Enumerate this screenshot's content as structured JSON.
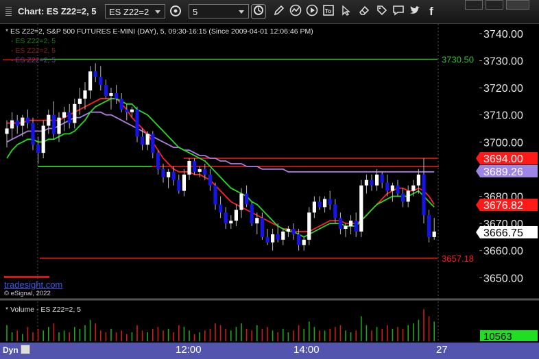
{
  "window": {
    "title": "Chart: ES Z22=2, 5",
    "symbol_combo": "ES Z22=2",
    "interval_combo": "5",
    "toolbar_icons": [
      "refresh-icon",
      "clock-icon",
      "pencil-icon",
      "chart-wave-icon",
      "play-icon",
      "to-icon",
      "eraser-icon",
      "comment-icon",
      "twitter-icon",
      "facebook-icon"
    ]
  },
  "chart_header": {
    "info": "* ES Z22=2, S&P 500 FUTURES E-MINI (DAY), 5, 09:30-16:15 (Since 2009-04-01 12:06:46 PM)",
    "overlay_1": "- ES Z22=2, 5",
    "overlay_2": "- ES Z22=2, 5",
    "overlay_3": "- ES Z22=2, 5"
  },
  "branding": {
    "site": "tradesight.com",
    "copyright": "© eSignal, 2022"
  },
  "volume_header": "* Volume - ES Z22=2, 5",
  "time_axis": {
    "dyn": "Dyn",
    "labels": [
      "12:00",
      "14:00",
      "27"
    ]
  },
  "colors": {
    "up_candle": "#ffffff",
    "down_candle": "#1515e8",
    "ma_green": "#22dd22",
    "ma_red": "#ff2222",
    "ma_purple": "#b07be0",
    "level_red": "#ff1a1a",
    "level_green": "#30c030",
    "axis_bg": "#5254ad",
    "volume_green": "#1aa81a",
    "volume_red": "#d01a1a"
  },
  "chart_data": {
    "type": "candlestick",
    "y_ticks": [
      "3740.00",
      "3730.00",
      "3720.00",
      "3710.00",
      "3700.00",
      "3690.00",
      "3680.00",
      "3670.00",
      "3660.00",
      "3650.00"
    ],
    "ylim": [
      3642.5,
      3743.5
    ],
    "candles": [
      [
        3703,
        3708,
        3698,
        3705
      ],
      [
        3705,
        3711,
        3701,
        3708
      ],
      [
        3708,
        3710,
        3703,
        3706
      ],
      [
        3706,
        3710,
        3702,
        3709
      ],
      [
        3709,
        3712,
        3705,
        3707
      ],
      [
        3707,
        3709,
        3697,
        3699
      ],
      [
        3699,
        3702,
        3692,
        3696
      ],
      [
        3696,
        3708,
        3694,
        3706
      ],
      [
        3706,
        3712,
        3703,
        3710
      ],
      [
        3710,
        3715,
        3701,
        3703
      ],
      [
        3703,
        3711,
        3700,
        3709
      ],
      [
        3709,
        3713,
        3704,
        3711
      ],
      [
        3711,
        3714,
        3705,
        3707
      ],
      [
        3707,
        3716,
        3705,
        3714
      ],
      [
        3714,
        3720,
        3710,
        3716
      ],
      [
        3716,
        3722,
        3712,
        3719
      ],
      [
        3719,
        3728,
        3716,
        3726
      ],
      [
        3726,
        3729,
        3722,
        3724
      ],
      [
        3724,
        3728,
        3719,
        3721
      ],
      [
        3721,
        3723,
        3716,
        3717
      ],
      [
        3717,
        3720,
        3712,
        3718
      ],
      [
        3718,
        3721,
        3714,
        3716
      ],
      [
        3716,
        3718,
        3711,
        3712
      ],
      [
        3712,
        3714,
        3708,
        3711
      ],
      [
        3711,
        3713,
        3709,
        3712
      ],
      [
        3712,
        3713,
        3700,
        3702
      ],
      [
        3702,
        3705,
        3697,
        3699
      ],
      [
        3699,
        3704,
        3697,
        3703
      ],
      [
        3703,
        3704,
        3694,
        3696
      ],
      [
        3696,
        3697,
        3688,
        3690
      ],
      [
        3690,
        3692,
        3685,
        3687
      ],
      [
        3687,
        3690,
        3683,
        3689
      ],
      [
        3689,
        3691,
        3684,
        3686
      ],
      [
        3686,
        3688,
        3681,
        3682
      ],
      [
        3682,
        3690,
        3680,
        3688
      ],
      [
        3688,
        3694,
        3686,
        3693
      ],
      [
        3693,
        3694,
        3688,
        3689
      ],
      [
        3689,
        3691,
        3687,
        3690
      ],
      [
        3690,
        3692,
        3686,
        3688
      ],
      [
        3688,
        3690,
        3682,
        3684
      ],
      [
        3684,
        3685,
        3675,
        3677
      ],
      [
        3677,
        3680,
        3672,
        3674
      ],
      [
        3674,
        3676,
        3668,
        3670
      ],
      [
        3670,
        3673,
        3668,
        3671
      ],
      [
        3671,
        3677,
        3669,
        3675
      ],
      [
        3675,
        3683,
        3672,
        3681
      ],
      [
        3681,
        3684,
        3676,
        3677
      ],
      [
        3677,
        3678,
        3669,
        3670
      ],
      [
        3670,
        3674,
        3666,
        3672
      ],
      [
        3672,
        3674,
        3664,
        3665
      ],
      [
        3665,
        3668,
        3662,
        3663
      ],
      [
        3663,
        3668,
        3660,
        3666
      ],
      [
        3666,
        3670,
        3663,
        3664
      ],
      [
        3664,
        3668,
        3662,
        3667
      ],
      [
        3667,
        3669,
        3665,
        3668
      ],
      [
        3668,
        3670,
        3664,
        3666
      ],
      [
        3666,
        3668,
        3660,
        3662
      ],
      [
        3662,
        3665,
        3660,
        3664
      ],
      [
        3664,
        3676,
        3662,
        3674
      ],
      [
        3674,
        3680,
        3672,
        3678
      ],
      [
        3678,
        3680,
        3675,
        3676
      ],
      [
        3676,
        3680,
        3674,
        3679
      ],
      [
        3679,
        3682,
        3675,
        3677
      ],
      [
        3677,
        3679,
        3670,
        3672
      ],
      [
        3672,
        3674,
        3666,
        3668
      ],
      [
        3668,
        3670,
        3665,
        3669
      ],
      [
        3669,
        3673,
        3666,
        3671
      ],
      [
        3671,
        3674,
        3665,
        3667
      ],
      [
        3667,
        3686,
        3665,
        3684
      ],
      [
        3684,
        3688,
        3681,
        3686
      ],
      [
        3686,
        3688,
        3682,
        3684
      ],
      [
        3684,
        3690,
        3682,
        3688
      ],
      [
        3688,
        3689,
        3683,
        3685
      ],
      [
        3685,
        3688,
        3680,
        3682
      ],
      [
        3682,
        3685,
        3678,
        3684
      ],
      [
        3684,
        3686,
        3680,
        3681
      ],
      [
        3681,
        3683,
        3676,
        3678
      ],
      [
        3678,
        3684,
        3676,
        3682
      ],
      [
        3682,
        3686,
        3680,
        3684
      ],
      [
        3684,
        3690,
        3681,
        3688
      ],
      [
        3688,
        3694,
        3670,
        3673
      ],
      [
        3673,
        3675,
        3663,
        3665
      ],
      [
        3665,
        3672,
        3664,
        3667
      ]
    ],
    "ma_green": [
      3694,
      3697,
      3699,
      3700,
      3701,
      3701,
      3700,
      3700,
      3701,
      3701,
      3702,
      3703,
      3703,
      3704,
      3706,
      3708,
      3711,
      3713,
      3714,
      3715,
      3716,
      3716,
      3715,
      3714,
      3714,
      3712,
      3711,
      3710,
      3708,
      3706,
      3704,
      3702,
      3700,
      3698,
      3697,
      3696,
      3695,
      3694,
      3693,
      3691,
      3689,
      3687,
      3685,
      3683,
      3682,
      3681,
      3680,
      3678,
      3677,
      3675,
      3673,
      3671,
      3669,
      3668,
      3667,
      3667,
      3666,
      3665,
      3666,
      3667,
      3668,
      3669,
      3670,
      3670,
      3670,
      3669,
      3669,
      3669,
      3671,
      3673,
      3675,
      3677,
      3678,
      3679,
      3680,
      3680,
      3680,
      3680,
      3681,
      3682,
      3680,
      3678,
      3676
    ],
    "ma_red": [
      3707,
      3707,
      3707,
      3707,
      3708,
      3708,
      3708,
      3708,
      3708,
      3708,
      3708,
      3709,
      3710,
      3711,
      3712,
      3713,
      3714,
      3715,
      3716,
      3716,
      3716,
      3716,
      3714,
      3712,
      3709,
      3707,
      3705,
      3703,
      3700,
      3697,
      3694,
      3692,
      3690,
      3689,
      3689,
      3689,
      3688,
      3688,
      3687,
      3686,
      3684,
      3682,
      3680,
      3678,
      3677,
      3676,
      3675,
      3674,
      3673,
      3672,
      3671,
      3670,
      3669,
      3668,
      3668,
      3667,
      3667,
      3667,
      3667,
      3668,
      3669,
      3670,
      3671,
      3671,
      3671,
      3670,
      3670,
      3670,
      3671,
      3673,
      3675,
      3677,
      3679,
      3681,
      3682,
      3683,
      3683,
      3682,
      3682,
      3683,
      3682,
      3680,
      3677
    ],
    "ma_purple": [
      3700,
      3701,
      3702,
      3703,
      3704,
      3704,
      3704,
      3704,
      3705,
      3705,
      3706,
      3707,
      3708,
      3709,
      3709,
      3710,
      3711,
      3711,
      3711,
      3710,
      3710,
      3709,
      3708,
      3707,
      3706,
      3705,
      3704,
      3703,
      3702,
      3701,
      3700,
      3699,
      3698,
      3698,
      3697,
      3697,
      3696,
      3695,
      3695,
      3694,
      3694,
      3693,
      3693,
      3692,
      3692,
      3692,
      3691,
      3691,
      3691,
      3690,
      3690,
      3690,
      3690,
      3690,
      3689,
      3689,
      3689,
      3689,
      3689,
      3689,
      3689,
      3689,
      3689,
      3689,
      3689,
      3689,
      3689,
      3689,
      3689,
      3689,
      3689,
      3689,
      3689,
      3689,
      3689,
      3689,
      3689,
      3689,
      3689,
      3689,
      3689,
      3689,
      3689
    ],
    "level_lines": [
      {
        "label": "3730.50",
        "value": 3730.5,
        "color": "#30c030"
      },
      {
        "label": "3657.18",
        "value": 3657.18,
        "color": "#ff1a1a"
      },
      {
        "label": "",
        "value": 3694,
        "color": "#ff1a1a"
      },
      {
        "label": "",
        "value": 3691,
        "color": "#ff1a1a"
      },
      {
        "label": "",
        "value": 3691,
        "color": "#30ff30"
      }
    ],
    "axis_tags": [
      {
        "label": "3694.00",
        "value": 3694,
        "bg": "#ff1a1a",
        "fg": "#ffffff"
      },
      {
        "label": "3689.26",
        "value": 3689.26,
        "bg": "#9e86e6",
        "fg": "#ffffff"
      },
      {
        "label": "3676.82",
        "value": 3676.82,
        "bg": "#ff1a1a",
        "fg": "#ffffff"
      },
      {
        "label": "3666.75",
        "value": 3666.75,
        "bg": "#ffffff",
        "fg": "#000000"
      }
    ],
    "volume": {
      "tag": "10563",
      "values": [
        9,
        5,
        6,
        4,
        8,
        5,
        7,
        6,
        8,
        10,
        5,
        6,
        5,
        8,
        7,
        9,
        12,
        10,
        6,
        5,
        7,
        5,
        6,
        4,
        5,
        9,
        6,
        5,
        7,
        8,
        6,
        7,
        5,
        9,
        8,
        6,
        4,
        5,
        6,
        7,
        10,
        9,
        7,
        6,
        8,
        10,
        7,
        6,
        9,
        7,
        8,
        6,
        5,
        7,
        5,
        6,
        9,
        7,
        11,
        8,
        6,
        6,
        7,
        8,
        9,
        6,
        5,
        6,
        14,
        9,
        6,
        8,
        7,
        9,
        7,
        8,
        7,
        9,
        10,
        12,
        18,
        14,
        11
      ]
    }
  }
}
